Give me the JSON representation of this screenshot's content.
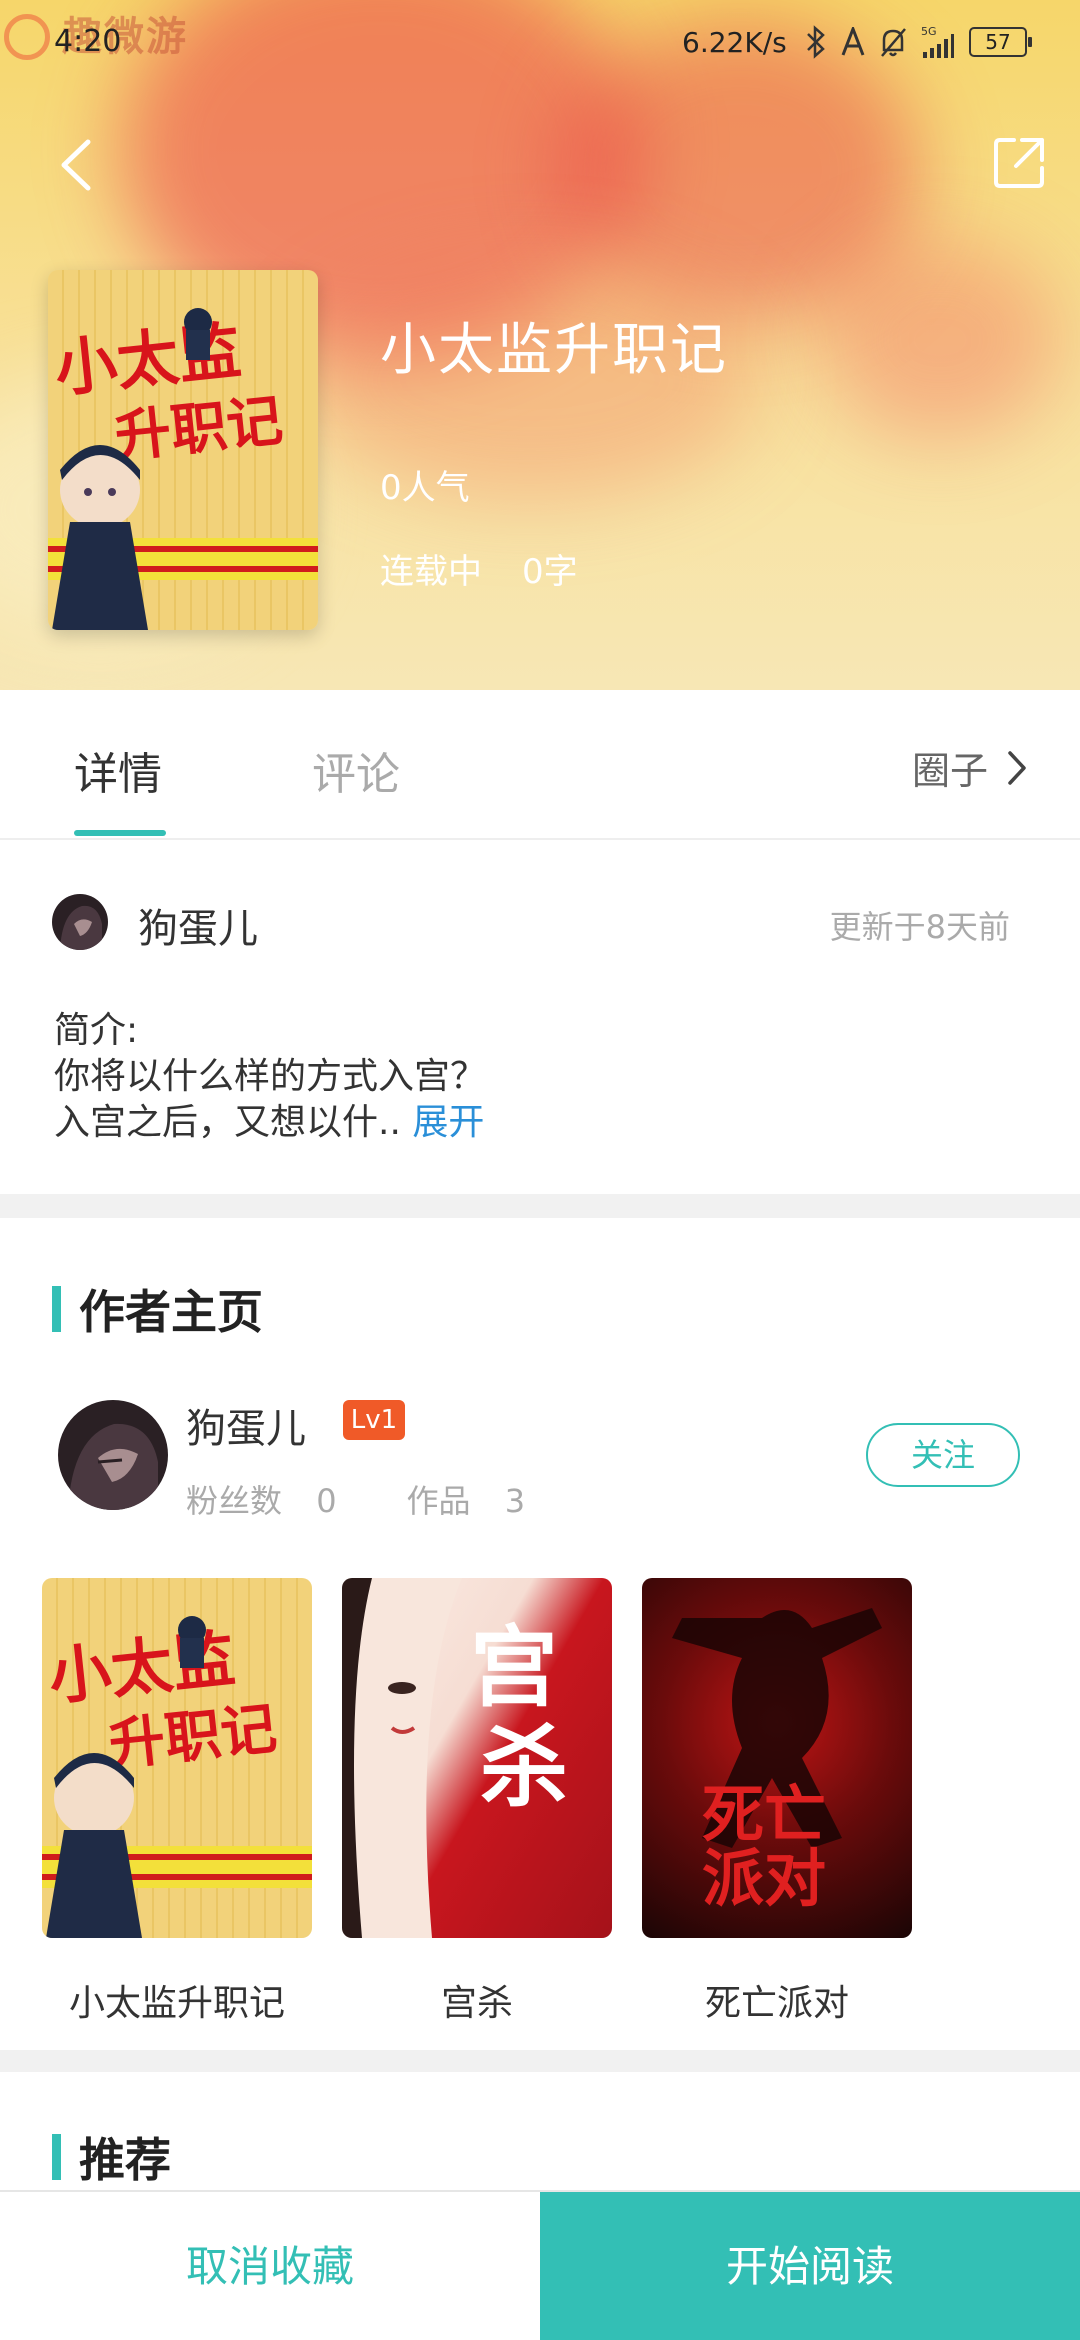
{
  "status_bar": {
    "watermark": "趣微游",
    "time": "4:20",
    "net_speed": "6.22K/s",
    "signal_label": "5G",
    "battery": "57"
  },
  "book": {
    "title": "小太监升职记",
    "popularity": "0人气",
    "serial_status": "连载中",
    "word_count": "0字"
  },
  "tabs": {
    "details": "详情",
    "comments": "评论",
    "circle": "圈子"
  },
  "author_line": {
    "name": "狗蛋儿",
    "updated": "更新于8天前"
  },
  "intro": {
    "label": "简介:",
    "line1": "你将以什么样的方式入宫？",
    "line2": "入宫之后，又想以什..",
    "expand": "展开"
  },
  "author_section": {
    "heading": "作者主页",
    "name": "狗蛋儿",
    "level": "Lv1",
    "fans_label": "粉丝数",
    "fans_count": "0",
    "works_label": "作品",
    "works_count": "3",
    "follow": "关注"
  },
  "works": [
    {
      "title": "小太监升职记",
      "cover_text": "小太监升职记"
    },
    {
      "title": "宫杀",
      "cover_text": "宫杀"
    },
    {
      "title": "死亡派对",
      "cover_text": "死亡派对"
    }
  ],
  "recommend": {
    "heading": "推荐"
  },
  "bottom_bar": {
    "unfavorite": "取消收藏",
    "start_reading": "开始阅读"
  },
  "colors": {
    "accent": "#33bfb5",
    "level_badge": "#f05a28",
    "link": "#2a8fd8"
  }
}
